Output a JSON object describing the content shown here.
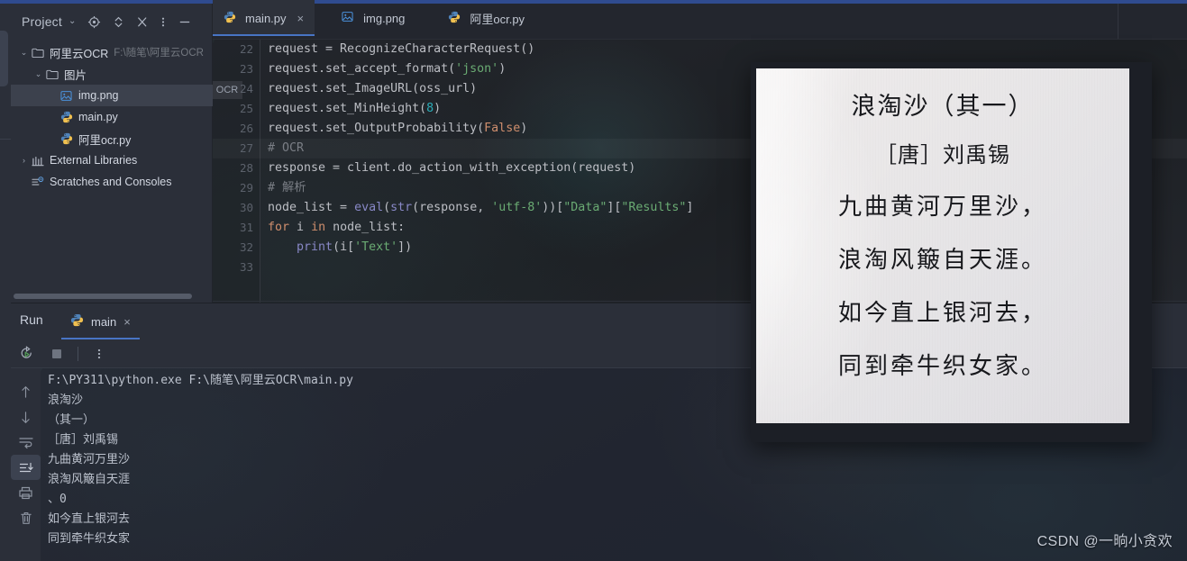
{
  "window": {
    "accent_color": "#2f4b8f",
    "background": "#1e2128"
  },
  "project_panel": {
    "title": "Project",
    "chevron": "⌄",
    "toolbar_icons": [
      "locate-icon",
      "expand-collapse-icon",
      "collapse-all-icon",
      "more-options-icon",
      "hide-panel-icon"
    ],
    "tree": [
      {
        "indent": 0,
        "arrow": "⌄",
        "icon": "folder-icon",
        "label": "阿里云OCR",
        "path": "F:\\随笔\\阿里云OCR",
        "selected": false
      },
      {
        "indent": 1,
        "arrow": "⌄",
        "icon": "folder-icon",
        "label": "图片",
        "path": "",
        "selected": false
      },
      {
        "indent": 2,
        "arrow": "",
        "icon": "image-file-icon",
        "label": "img.png",
        "path": "",
        "selected": true
      },
      {
        "indent": 2,
        "arrow": "",
        "icon": "python-file-icon",
        "label": "main.py",
        "path": "",
        "selected": false
      },
      {
        "indent": 2,
        "arrow": "",
        "icon": "python-file-icon",
        "label": "阿里ocr.py",
        "path": "",
        "selected": false
      },
      {
        "indent": 0,
        "arrow": "›",
        "icon": "libraries-icon",
        "label": "External Libraries",
        "path": "",
        "selected": false
      },
      {
        "indent": 0,
        "arrow": "",
        "icon": "scratches-icon",
        "label": "Scratches and Consoles",
        "path": "",
        "selected": false
      }
    ]
  },
  "editor": {
    "tabs": [
      {
        "label": "main.py",
        "icon": "python-file-icon",
        "active": true,
        "closable": true,
        "close_glyph": "×"
      },
      {
        "label": "img.png",
        "icon": "image-file-icon",
        "active": false,
        "closable": false,
        "close_glyph": ""
      },
      {
        "label": "阿里ocr.py",
        "icon": "python-file-icon",
        "active": false,
        "closable": false,
        "close_glyph": ""
      }
    ],
    "breadcrumb_badge": "OCR",
    "current_line": 27,
    "lines": [
      {
        "n": 22,
        "tokens": [
          {
            "t": "request = RecognizeCharacterRequest()",
            "c": "tok-def"
          }
        ]
      },
      {
        "n": 23,
        "tokens": [
          {
            "t": "request.set_accept_format(",
            "c": "tok-def"
          },
          {
            "t": "'json'",
            "c": "tok-str"
          },
          {
            "t": ")",
            "c": "tok-def"
          }
        ]
      },
      {
        "n": 24,
        "tokens": [
          {
            "t": "request.set_ImageURL(oss_url)",
            "c": "tok-def"
          }
        ]
      },
      {
        "n": 25,
        "tokens": [
          {
            "t": "request.set_MinHeight(",
            "c": "tok-def"
          },
          {
            "t": "8",
            "c": "tok-num"
          },
          {
            "t": ")",
            "c": "tok-def"
          }
        ]
      },
      {
        "n": 26,
        "tokens": [
          {
            "t": "request.set_OutputProbability(",
            "c": "tok-def"
          },
          {
            "t": "False",
            "c": "tok-kw"
          },
          {
            "t": ")",
            "c": "tok-def"
          }
        ]
      },
      {
        "n": 27,
        "tokens": [
          {
            "t": "# OCR",
            "c": "tok-cm"
          }
        ]
      },
      {
        "n": 28,
        "tokens": [
          {
            "t": "response = client.do_action_with_exception(request)",
            "c": "tok-def"
          }
        ]
      },
      {
        "n": 29,
        "tokens": [
          {
            "t": "# 解析",
            "c": "tok-cm"
          }
        ]
      },
      {
        "n": 30,
        "tokens": [
          {
            "t": "node_list = ",
            "c": "tok-def"
          },
          {
            "t": "eval",
            "c": "tok-builtin"
          },
          {
            "t": "(",
            "c": "tok-def"
          },
          {
            "t": "str",
            "c": "tok-builtin"
          },
          {
            "t": "(response, ",
            "c": "tok-def"
          },
          {
            "t": "'utf-8'",
            "c": "tok-str"
          },
          {
            "t": "))[",
            "c": "tok-def"
          },
          {
            "t": "\"Data\"",
            "c": "tok-str"
          },
          {
            "t": "][",
            "c": "tok-def"
          },
          {
            "t": "\"Results\"",
            "c": "tok-str"
          },
          {
            "t": "]",
            "c": "tok-def"
          }
        ]
      },
      {
        "n": 31,
        "tokens": [
          {
            "t": "for",
            "c": "tok-kw"
          },
          {
            "t": " i ",
            "c": "tok-def"
          },
          {
            "t": "in",
            "c": "tok-kw"
          },
          {
            "t": " node_list:",
            "c": "tok-def"
          }
        ]
      },
      {
        "n": 32,
        "tokens": [
          {
            "t": "    ",
            "c": "tok-def"
          },
          {
            "t": "print",
            "c": "tok-fn"
          },
          {
            "t": "(i[",
            "c": "tok-def"
          },
          {
            "t": "'Text'",
            "c": "tok-str"
          },
          {
            "t": "])",
            "c": "tok-def"
          }
        ]
      },
      {
        "n": 33,
        "tokens": []
      }
    ]
  },
  "run_panel": {
    "label": "Run",
    "tab": {
      "label": "main",
      "icon": "python-file-icon",
      "close_glyph": "×"
    },
    "toolbar_icons": [
      "rerun-icon",
      "stop-icon",
      "more-options-icon"
    ],
    "sidebar_icons": [
      "scroll-up-icon",
      "scroll-down-icon",
      "soft-wrap-icon",
      "scroll-to-end-icon",
      "print-icon",
      "clear-all-icon"
    ],
    "console_lines": [
      "F:\\PY311\\python.exe F:\\随笔\\阿里云OCR\\main.py",
      "浪淘沙",
      "（其一）",
      "［唐］刘禹锡",
      "九曲黄河万里沙",
      "浪淘风簸自天涯",
      "、0",
      "如今直上银河去",
      "同到牵牛织女家"
    ]
  },
  "image_preview": {
    "name": "img.png",
    "poem_title": "浪淘沙（其一）",
    "poem_author": "［唐］刘禹锡",
    "poem_verses": [
      "九曲黄河万里沙，",
      "浪淘风簸自天涯。",
      "如今直上银河去，",
      "同到牵牛织女家。"
    ]
  },
  "watermark": {
    "text": "CSDN @一晌小贪欢"
  }
}
